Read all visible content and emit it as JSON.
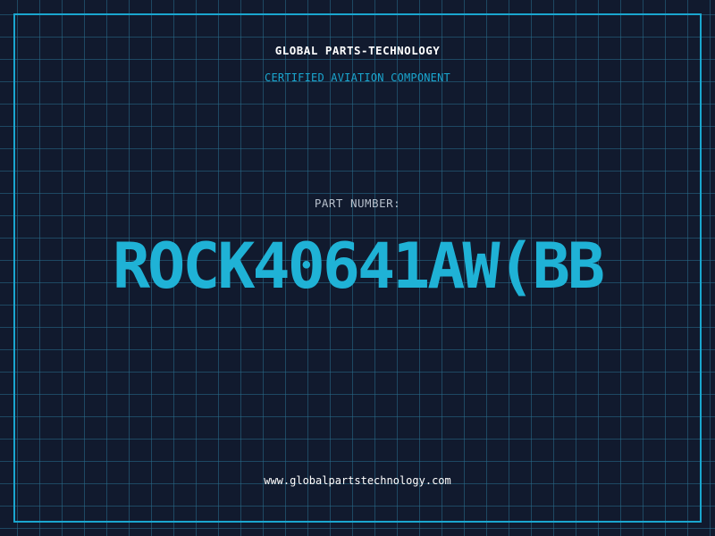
{
  "header": {
    "company": "GLOBAL PARTS-TECHNOLOGY",
    "subtitle": "CERTIFIED AVIATION COMPONENT"
  },
  "part": {
    "label": "PART NUMBER:",
    "number": "ROCK40641AW(BB"
  },
  "footer": {
    "website": "www.globalpartstechnology.com"
  },
  "colors": {
    "background": "#111a2e",
    "grid": "#286e8c",
    "accent": "#1aa6cf",
    "text": "#ffffff"
  }
}
